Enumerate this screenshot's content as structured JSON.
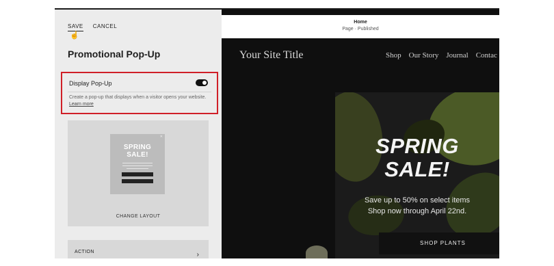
{
  "panel": {
    "save_label": "SAVE",
    "cancel_label": "CANCEL",
    "title": "Promotional Pop-Up",
    "toggle": {
      "label": "Display Pop-Up",
      "checked": true,
      "description": "Create a pop-up that displays when a visitor opens your website.",
      "link": "Learn more"
    },
    "layout": {
      "thumb_title_line1": "SPRING",
      "thumb_title_line2": "SALE!",
      "change_label": "CHANGE LAYOUT"
    },
    "action_label": "ACTION"
  },
  "preview": {
    "page_title": "Home",
    "page_status": "Page · Published",
    "site_title": "Your Site Title",
    "nav": [
      "Shop",
      "Our Story",
      "Journal",
      "Contac"
    ],
    "popup": {
      "title_line1": "SPRING",
      "title_line2": "SALE!",
      "line1": "Save up to 50% on select items",
      "line2": "Shop now through April 22nd.",
      "button": "SHOP PLANTS"
    }
  },
  "colors": {
    "highlight_border": "#d01f27",
    "panel_bg": "#ececec",
    "preview_bg": "#0f0f0f"
  }
}
